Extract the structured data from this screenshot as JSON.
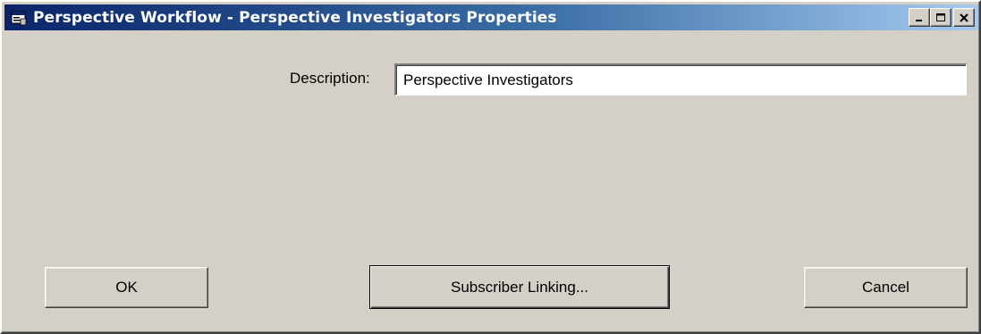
{
  "window": {
    "title": "Perspective Workflow - Perspective Investigators Properties",
    "icon": "app-window-icon",
    "minimize_icon": "minimize-icon",
    "maximize_icon": "maximize-icon",
    "close_icon": "close-icon"
  },
  "form": {
    "description_label": "Description:",
    "description_value": "Perspective Investigators"
  },
  "buttons": {
    "ok_label": "OK",
    "subscriber_linking_label": "Subscriber Linking...",
    "cancel_label": "Cancel"
  },
  "colors": {
    "face": "#d4d0c8",
    "title_start": "#0a246a",
    "title_end": "#a6caf0",
    "title_text": "#ffffff"
  }
}
